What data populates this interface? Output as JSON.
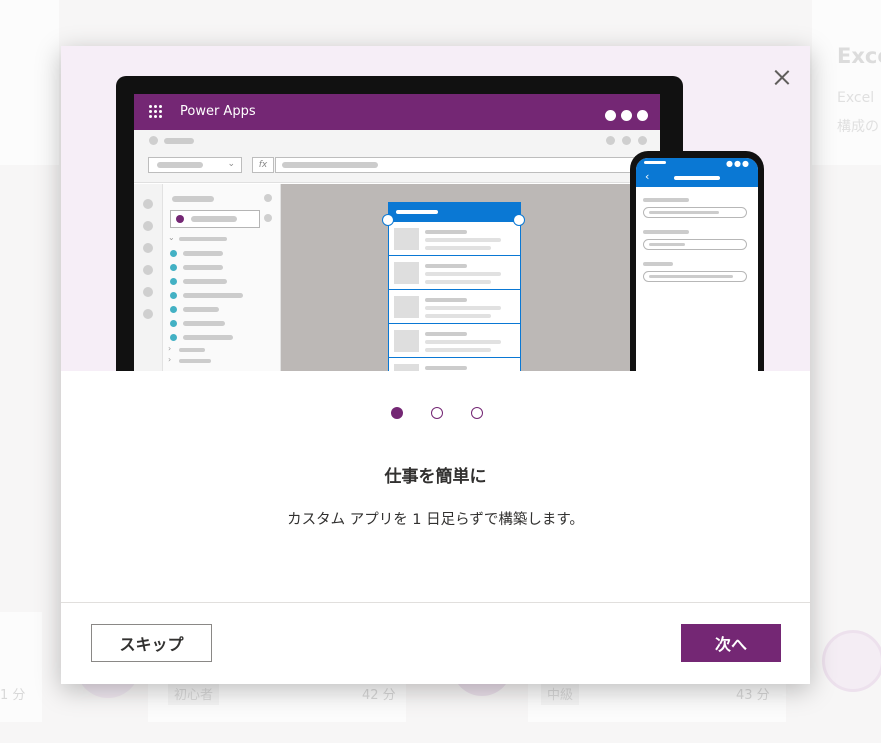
{
  "background": {
    "card_title": "Exce",
    "card_desc_1": "Excel",
    "card_desc_2": "構成の",
    "items": [
      {
        "duration": "1 分"
      },
      {
        "level": "初心者",
        "duration": "42 分"
      },
      {
        "level": "中級",
        "duration": "43 分"
      }
    ]
  },
  "illustration": {
    "app_title": "Power Apps",
    "formula_icon": "fx"
  },
  "pager": {
    "count": 3,
    "active_index": 0
  },
  "slide": {
    "title": "仕事を簡単に",
    "description": "カスタム アプリを 1 日足らずで構築します。"
  },
  "footer": {
    "skip_label": "スキップ",
    "next_label": "次へ"
  },
  "colors": {
    "brand": "#742774",
    "accent_blue": "#0a78d4",
    "hero_background": "#f6eef7"
  },
  "icons": [
    "close-icon",
    "waffle-icon",
    "more-icon",
    "chevron-left-icon",
    "image-placeholder-icon"
  ]
}
